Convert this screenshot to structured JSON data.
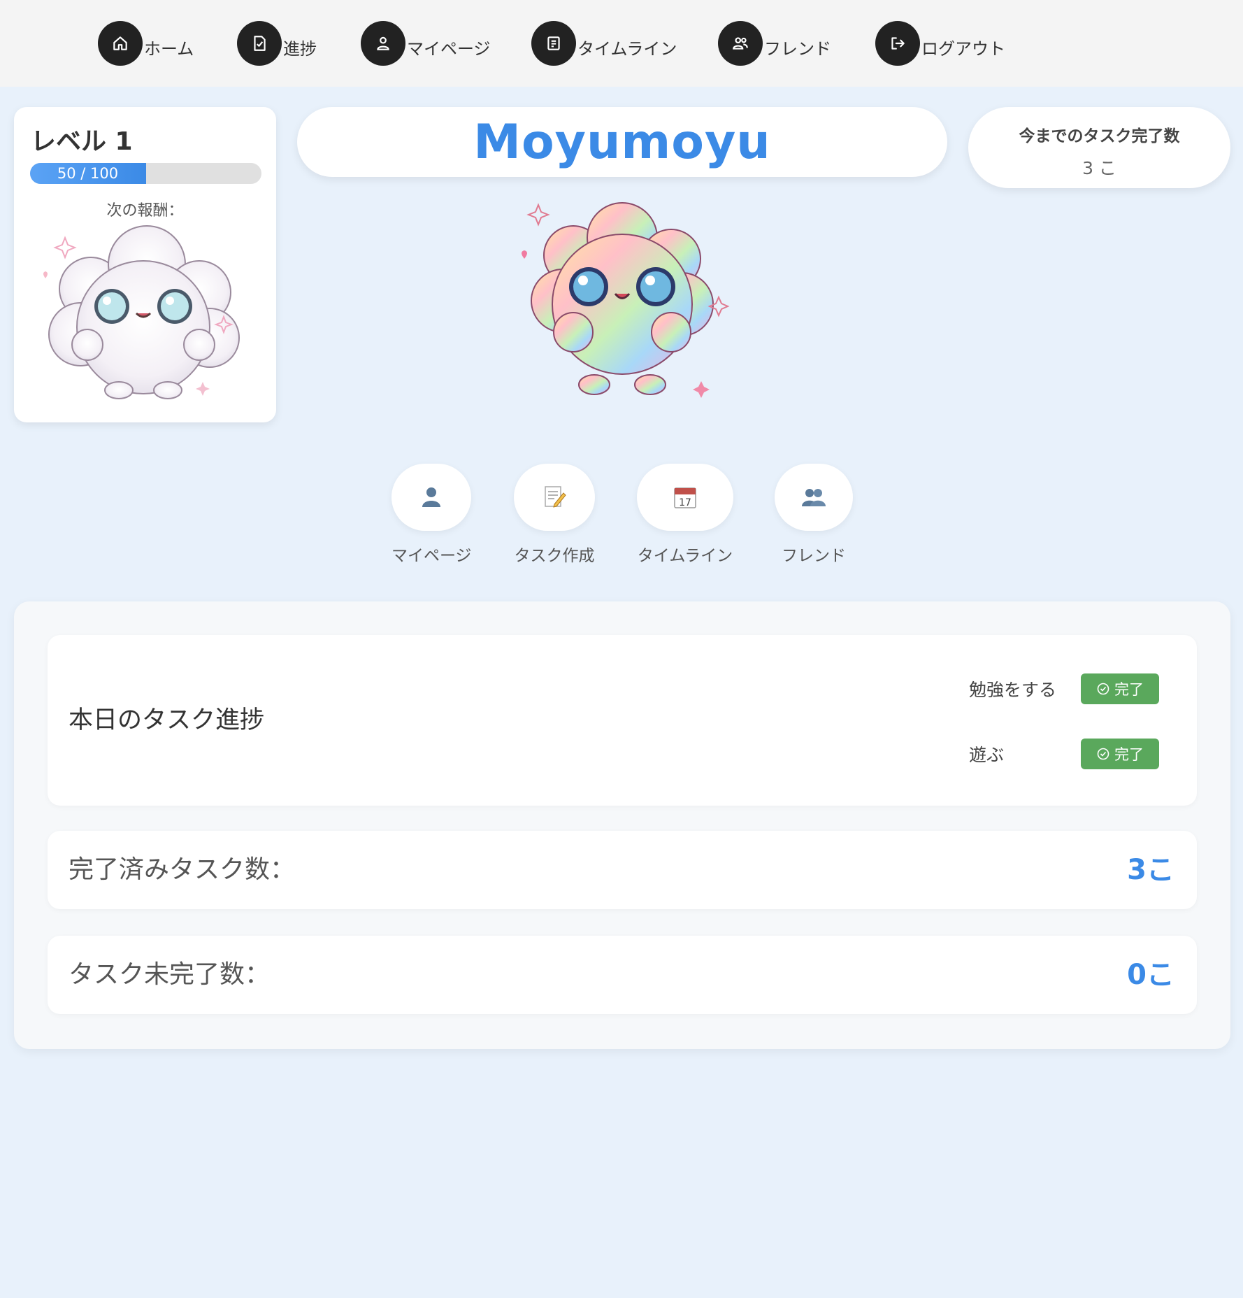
{
  "nav": {
    "items": [
      {
        "label": "ホーム",
        "icon": "home-icon"
      },
      {
        "label": "進捗",
        "icon": "clipboard-check-icon"
      },
      {
        "label": "マイページ",
        "icon": "user-icon"
      },
      {
        "label": "タイムライン",
        "icon": "timeline-icon"
      },
      {
        "label": "フレンド",
        "icon": "friends-icon"
      },
      {
        "label": "ログアウト",
        "icon": "logout-icon"
      }
    ]
  },
  "level": {
    "title": "レベル 1",
    "xp_text": "50 / 100",
    "xp_current": 50,
    "xp_max": 100,
    "reward_label": "次の報酬："
  },
  "profile": {
    "name": "Moyumoyu"
  },
  "total": {
    "label": "今までのタスク完了数",
    "value": "3 こ"
  },
  "quick_actions": [
    {
      "label": "マイページ",
      "icon": "user-icon"
    },
    {
      "label": "タスク作成",
      "icon": "memo-icon"
    },
    {
      "label": "タイムライン",
      "icon": "calendar-icon"
    },
    {
      "label": "フレンド",
      "icon": "friends-icon"
    }
  ],
  "today": {
    "title": "本日のタスク進捗",
    "tasks": [
      {
        "name": "勉強をする",
        "status": "完了"
      },
      {
        "name": "遊ぶ",
        "status": "完了"
      }
    ]
  },
  "stats": {
    "completed_label": "完了済みタスク数：",
    "completed_value": "3こ",
    "incomplete_label": "タスク未完了数：",
    "incomplete_value": "0こ"
  },
  "colors": {
    "accent": "#3b8ae6",
    "success": "#5aa85c",
    "background": "#e8f1fb",
    "nav_icon_bg": "#222222"
  }
}
